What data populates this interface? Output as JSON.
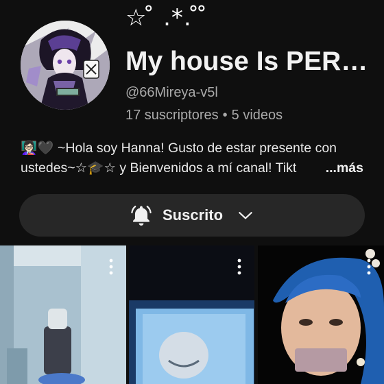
{
  "channel": {
    "decoration": "☆ ̊ .*. ̊ ̊",
    "title": "My house Is PER…",
    "handle": "@66Mireya-v5l",
    "subscribers": "17 suscriptores",
    "separator": "•",
    "videos": "5 videos",
    "avatar_icon": "anime-character-avatar"
  },
  "description": {
    "line1": "👩🏻‍🏫🖤 ~Hola soy Hanna! Gusto de estar presente con",
    "line2": "ustedes~☆🎓☆ y Bienvenidos a mí canal! Tikt",
    "more": "...más"
  },
  "subscribe": {
    "label": "Suscrito",
    "bell_icon": "bell-icon",
    "chevron_icon": "chevron-down-icon"
  },
  "videos": [
    {
      "menu_icon": "more-vert-icon"
    },
    {
      "menu_icon": "more-vert-icon"
    },
    {
      "menu_icon": "more-vert-icon"
    }
  ],
  "colors": {
    "background": "#0f0f0f",
    "button": "#272727",
    "text_primary": "#f1f1f1",
    "text_secondary": "#aaaaaa"
  }
}
